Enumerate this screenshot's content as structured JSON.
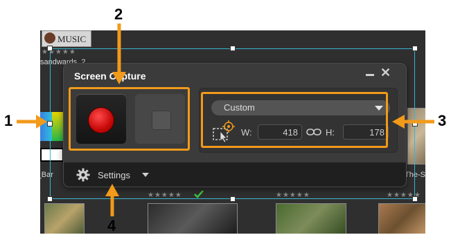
{
  "background": {
    "logo_text": "MUSIC",
    "folder_label": "sandwards_2",
    "left_clip_label": "r_Bar",
    "right_clip_label": "The-S",
    "rating_stars": "★★★★★"
  },
  "dialog": {
    "title": "Screen Capture",
    "minimize_symbol": "–",
    "close_symbol": "✕",
    "mode_value": "Custom",
    "width_label": "W:",
    "width_value": "418",
    "height_label": "H:",
    "height_value": "178",
    "settings_label": "Settings"
  },
  "callouts": {
    "one": "1",
    "two": "2",
    "three": "3",
    "four": "4"
  },
  "colors": {
    "callout": "#f29a1a",
    "region_border": "#39b6d0",
    "record_red": "#d10f0f",
    "selection_cursor": "#f29a1a"
  },
  "icons": [
    "minimize-icon",
    "close-icon",
    "record-icon",
    "stop-icon",
    "dropdown-arrow-icon",
    "select-region-icon",
    "link-icon",
    "gear-icon",
    "checkmark-icon"
  ]
}
